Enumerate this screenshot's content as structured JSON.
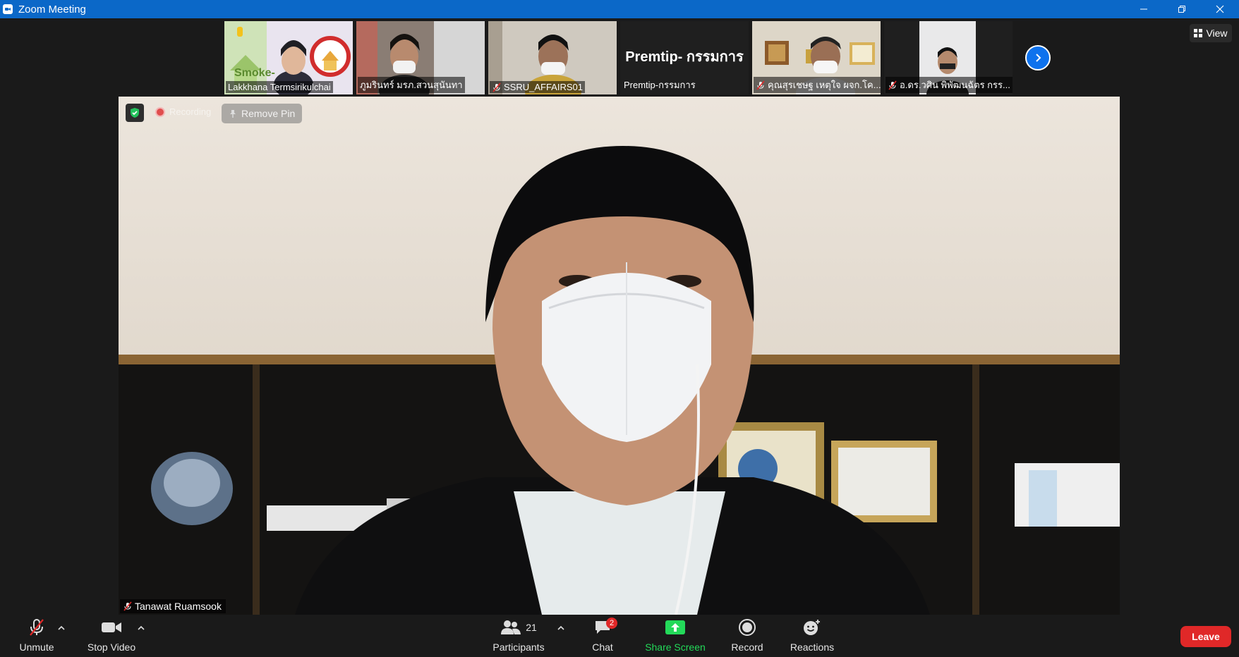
{
  "window": {
    "title": "Zoom Meeting"
  },
  "gallery": {
    "participants": [
      {
        "name": "Lakkhana Termsirikulchai",
        "muted": false
      },
      {
        "name": "ภูมรินทร์ มรภ.สวนสุนันทา",
        "muted": false
      },
      {
        "name": "SSRU_AFFAIRS01",
        "muted": true
      },
      {
        "name": "Premtip-กรรมการ",
        "display_name": "Premtip- กรรมการ",
        "muted": false
      },
      {
        "name": "คุณสุรเชษฐ เหตุใจ ผจก.โค...",
        "muted": true
      },
      {
        "name": "อ.ดร.วศิน พิพัฒนฉัตร กรร...",
        "muted": true
      }
    ],
    "thumb_logo_text": "Smoke-"
  },
  "view_button": {
    "label": "View"
  },
  "main": {
    "recording_label": "Recording",
    "remove_pin_label": "Remove Pin",
    "speaker_name": "Tanawat Ruamsook"
  },
  "toolbar": {
    "unmute_label": "Unmute",
    "stop_video_label": "Stop Video",
    "participants_label": "Participants",
    "participants_count": "21",
    "chat_label": "Chat",
    "chat_badge": "2",
    "share_label": "Share Screen",
    "record_label": "Record",
    "reactions_label": "Reactions",
    "leave_label": "Leave"
  },
  "colors": {
    "titlebar": "#0b68c8",
    "share_green": "#23d959",
    "leave_red": "#e02828",
    "accent_blue": "#0e72ed"
  }
}
